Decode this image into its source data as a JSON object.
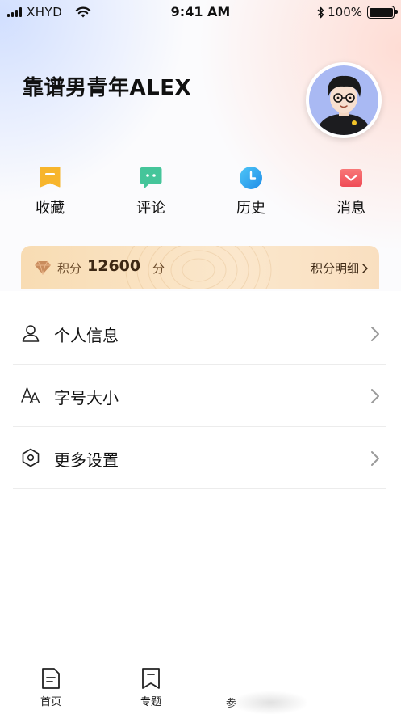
{
  "status_bar": {
    "carrier": "XHYD",
    "time": "9:41 AM",
    "battery": "100%"
  },
  "profile": {
    "username": "靠谱男青年ALEX"
  },
  "quick_actions": [
    {
      "label": "收藏",
      "icon": "bookmark-icon",
      "color": "#f7b52c"
    },
    {
      "label": "评论",
      "icon": "comment-icon",
      "color": "#45c59a"
    },
    {
      "label": "历史",
      "icon": "clock-icon",
      "color": "#2fa4f0"
    },
    {
      "label": "消息",
      "icon": "mail-icon",
      "color": "#f2545b"
    }
  ],
  "points": {
    "label": "积分",
    "value": "12600",
    "unit": "分",
    "detail_link": "积分明细"
  },
  "menu": [
    {
      "label": "个人信息",
      "icon": "user-icon"
    },
    {
      "label": "字号大小",
      "icon": "font-size-icon"
    },
    {
      "label": "更多设置",
      "icon": "settings-hexagon-icon"
    }
  ],
  "tabbar": [
    {
      "label": "首页",
      "icon": "document-icon"
    },
    {
      "label": "专题",
      "icon": "bookmark-outline-icon"
    },
    {
      "label": "参",
      "icon": ""
    }
  ]
}
